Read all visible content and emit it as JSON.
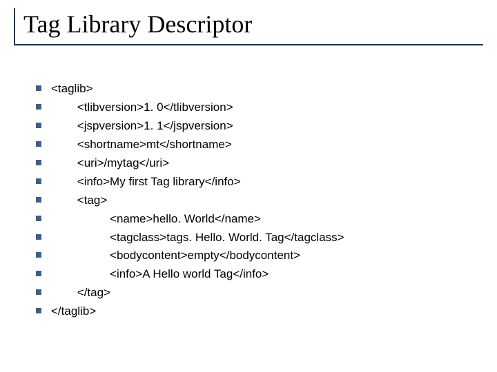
{
  "title": "Tag Library Descriptor",
  "lines": [
    "<taglib>",
    "        <tlibversion>1. 0</tlibversion>",
    "        <jspversion>1. 1</jspversion>",
    "        <shortname>mt</shortname>",
    "        <uri>/mytag</uri>",
    "        <info>My first Tag library</info>",
    "        <tag>",
    "                  <name>hello. World</name>",
    "                  <tagclass>tags. Hello. World. Tag</tagclass>",
    "                  <bodycontent>empty</bodycontent>",
    "                  <info>A Hello world Tag</info>",
    "        </tag>",
    "</taglib>"
  ]
}
